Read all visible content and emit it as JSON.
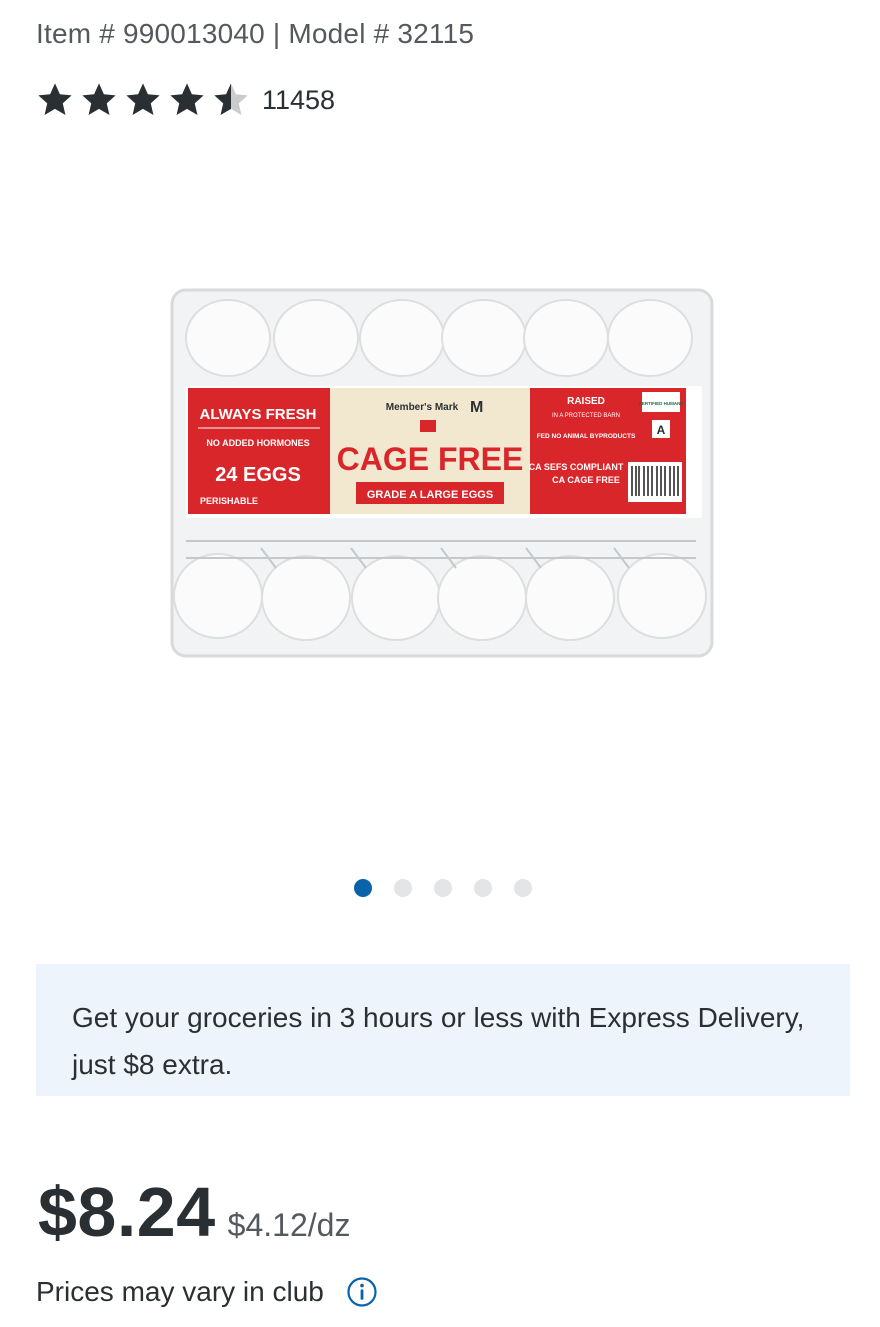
{
  "product": {
    "item_line": "Item # 990013040 | Model # 32115",
    "rating_stars": 4.5,
    "review_count": "11458",
    "image": {
      "brand": "Member's Mark",
      "label_left_1": "ALWAYS FRESH",
      "label_left_2": "NO ADDED HORMONES",
      "label_left_3": "24 EGGS",
      "label_left_4": "PERISHABLE",
      "label_center_1": "CAGE FREE",
      "label_center_2": "GRADE A LARGE EGGS",
      "label_right_1": "RAISED",
      "label_right_2": "IN A PROTECTED BARN",
      "label_right_3": "FED NO ANIMAL BYPRODUCTS",
      "label_right_4": "CA SEFS COMPLIANT",
      "label_right_5": "CA CAGE FREE",
      "badge_text": "CERTIFIED HUMANE",
      "grade_text": "A"
    },
    "carousel": {
      "count": 5,
      "active": 0
    }
  },
  "banner": {
    "text": "Get your groceries in 3 hours or less with Express Delivery, just $8 extra."
  },
  "pricing": {
    "price": "$8.24",
    "unit_price": "$4.12/dz",
    "note": "Prices may vary in club"
  },
  "colors": {
    "text_primary": "#2a2f33",
    "text_secondary": "#55595d",
    "accent": "#0a63a8",
    "banner_bg": "#eef4fb",
    "label_red": "#d9262b",
    "label_cream": "#f1e8cf"
  },
  "icons": {
    "star": "star-icon",
    "info": "info-icon"
  }
}
